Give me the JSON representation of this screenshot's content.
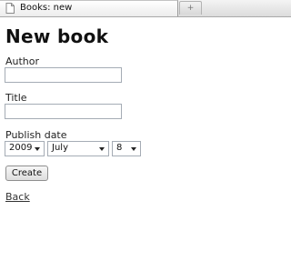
{
  "browser": {
    "tab_title": "Books: new",
    "new_tab_symbol": "+"
  },
  "form": {
    "heading": "New book",
    "author_label": "Author",
    "author_value": "",
    "title_label": "Title",
    "title_value": "",
    "publish_date_label": "Publish date",
    "year_selected": "2009",
    "month_selected": "July",
    "day_selected": "8",
    "submit_label": "Create"
  },
  "nav": {
    "back_label": "Back"
  },
  "icons": {
    "tab": "page-icon",
    "new_tab": "plus-icon",
    "dropdown": "chevron-down-icon"
  }
}
